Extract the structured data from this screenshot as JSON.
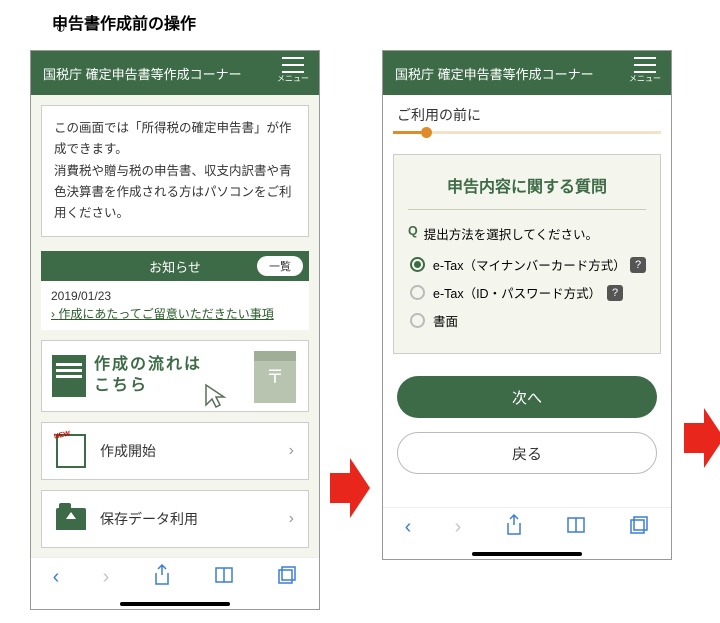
{
  "page": {
    "marker": "○",
    "title": "申告書作成前の操作"
  },
  "shared_header": {
    "title": "国税庁 確定申告書等作成コーナー",
    "menu_label": "メニュー"
  },
  "phone1": {
    "info_text": "この画面では「所得税の確定申告書」が作成できます。\n消費税や贈与税の申告書、収支内訳書や青色決算書を作成される方はパソコンをご利用ください。",
    "notice_title": "お知らせ",
    "notice_list_btn": "一覧",
    "notice_date": "2019/01/23",
    "notice_link": "作成にあたってご留意いただきたい事項",
    "flow_line1": "作成の流れは",
    "flow_line2": "こちら",
    "start_label": "作成開始",
    "saved_label": "保存データ利用"
  },
  "phone2": {
    "breadcrumb": "ご利用の前に",
    "section_title": "申告内容に関する質問",
    "q_badge": "Q",
    "question": "提出方法を選択してください。",
    "options": [
      {
        "label": "e-Tax（マイナンバーカード方式）",
        "selected": true,
        "help": true
      },
      {
        "label": "e-Tax（ID・パスワード方式）",
        "selected": false,
        "help": true
      },
      {
        "label": "書面",
        "selected": false,
        "help": false
      }
    ],
    "next_btn": "次へ",
    "back_btn": "戻る"
  },
  "help_glyph": "?"
}
